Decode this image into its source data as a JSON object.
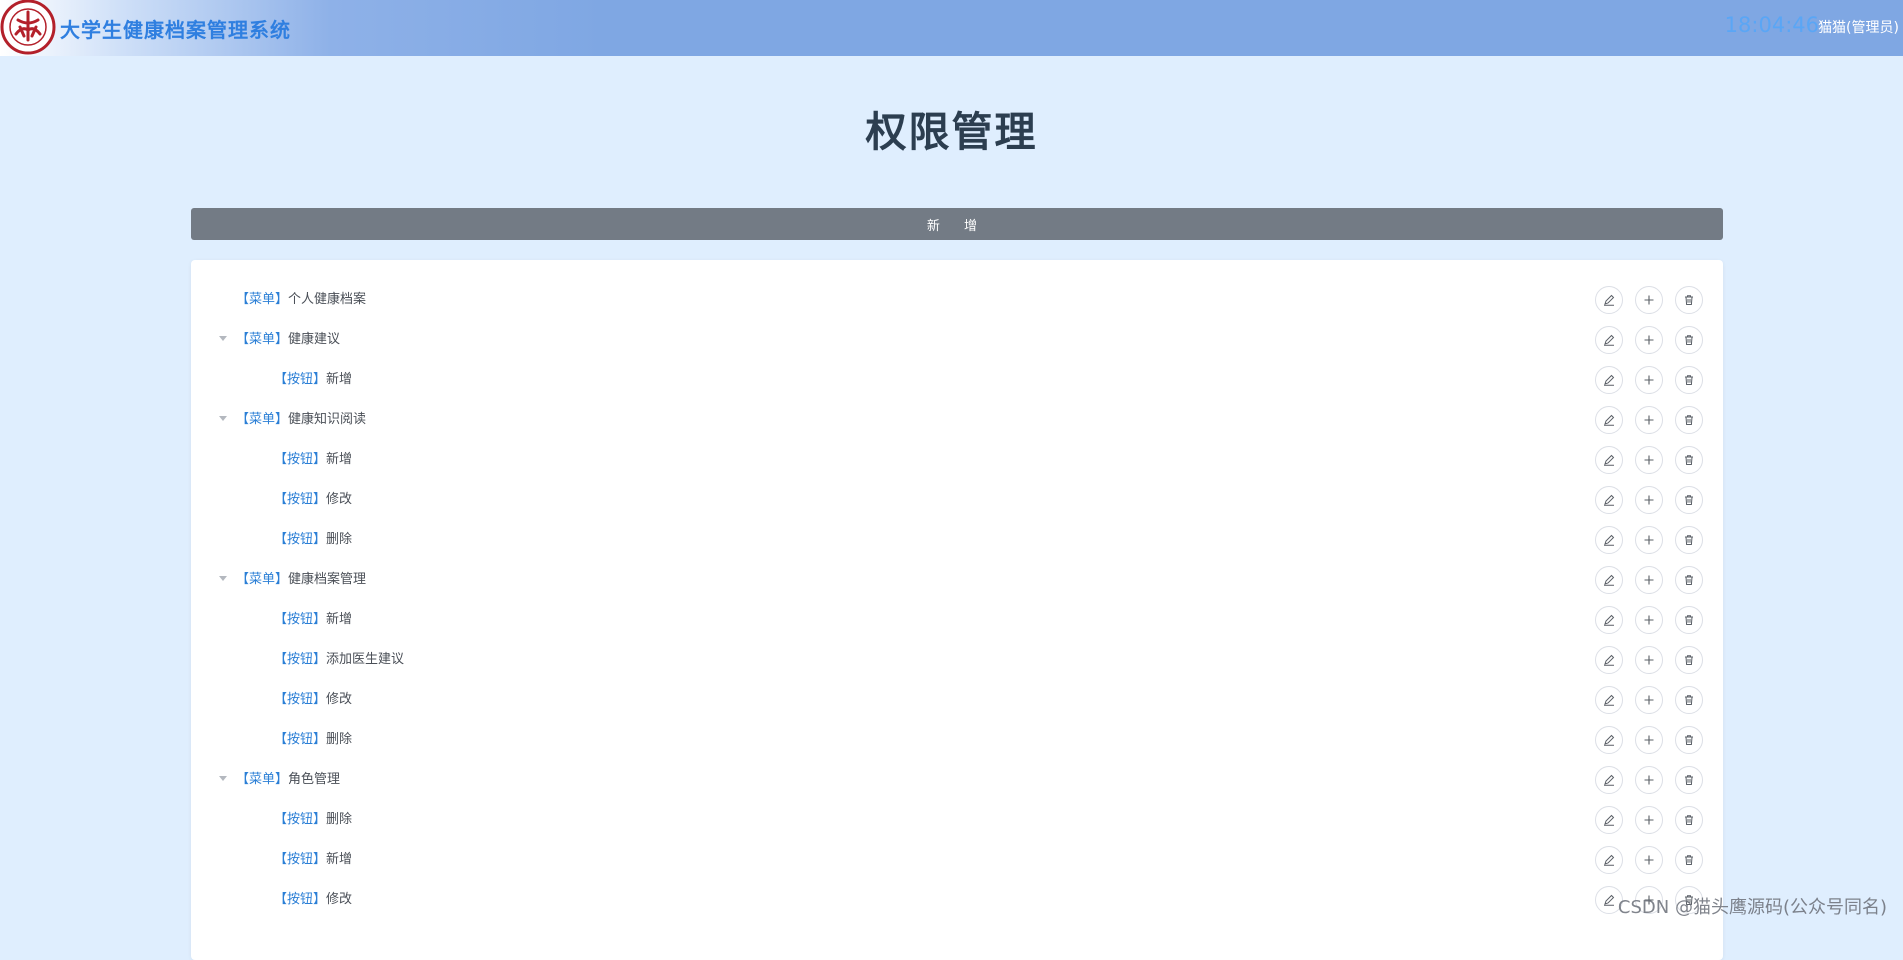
{
  "header": {
    "app_title": "大学生健康档案管理系统",
    "clock": "18:04:46",
    "user": "猫猫(管理员)"
  },
  "page": {
    "title": "权限管理",
    "add_label": "新 增"
  },
  "tree": [
    {
      "type": "【菜单】",
      "name": "个人健康档案",
      "level": 0,
      "caret": false
    },
    {
      "type": "【菜单】",
      "name": "健康建议",
      "level": 0,
      "caret": true
    },
    {
      "type": "【按钮】",
      "name": "新增",
      "level": 1,
      "caret": false
    },
    {
      "type": "【菜单】",
      "name": "健康知识阅读",
      "level": 0,
      "caret": true
    },
    {
      "type": "【按钮】",
      "name": "新增",
      "level": 1,
      "caret": false
    },
    {
      "type": "【按钮】",
      "name": "修改",
      "level": 1,
      "caret": false
    },
    {
      "type": "【按钮】",
      "name": "删除",
      "level": 1,
      "caret": false
    },
    {
      "type": "【菜单】",
      "name": "健康档案管理",
      "level": 0,
      "caret": true
    },
    {
      "type": "【按钮】",
      "name": "新增",
      "level": 1,
      "caret": false
    },
    {
      "type": "【按钮】",
      "name": "添加医生建议",
      "level": 1,
      "caret": false
    },
    {
      "type": "【按钮】",
      "name": "修改",
      "level": 1,
      "caret": false
    },
    {
      "type": "【按钮】",
      "name": "删除",
      "level": 1,
      "caret": false
    },
    {
      "type": "【菜单】",
      "name": "角色管理",
      "level": 0,
      "caret": true
    },
    {
      "type": "【按钮】",
      "name": "删除",
      "level": 1,
      "caret": false
    },
    {
      "type": "【按钮】",
      "name": "新增",
      "level": 1,
      "caret": false
    },
    {
      "type": "【按钮】",
      "name": "修改",
      "level": 1,
      "caret": false
    }
  ],
  "row_actions": [
    "edit-icon",
    "plus-icon",
    "delete-icon"
  ],
  "colors": {
    "accent": "#2b7fd6",
    "header": "#7fa7e3",
    "add_button": "#737b85"
  },
  "watermark": "CSDN @猫头鹰源码(公众号同名)"
}
